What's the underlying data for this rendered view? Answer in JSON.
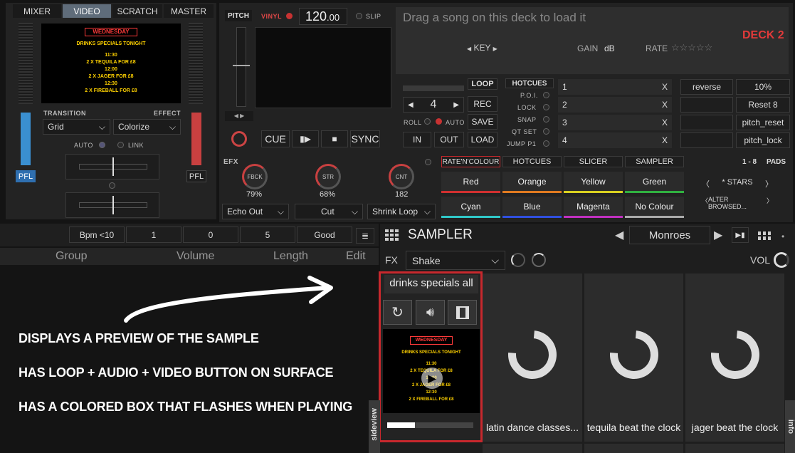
{
  "mixer": {
    "tabs": [
      "MIXER",
      "VIDEO",
      "SCRATCH",
      "MASTER"
    ],
    "active_tab": "VIDEO",
    "transition_label": "TRANSITION",
    "effect_label": "EFFECT",
    "transition_value": "Grid",
    "effect_value": "Colorize",
    "auto_label": "AUTO",
    "link_label": "LINK",
    "pfl_left": "PFL",
    "pfl_right": "PFL"
  },
  "preview_text": {
    "logo": "WEDNESDAY",
    "l1": "DRINKS SPECIALS TONIGHT",
    "l2": "11:30",
    "l3": "2 X TEQUILA FOR £8",
    "l4": "12:00",
    "l5": "2 X JAGER FOR £8",
    "l6": "12:30",
    "l7": "2 X FIREBALL FOR £8"
  },
  "deck": {
    "pitch_label": "PITCH",
    "vinyl_label": "VINYL",
    "bpm": "120",
    "bpm_dec": ".00",
    "slip_label": "SLIP",
    "drop_text": "Drag a song on this deck to load it",
    "deck_name": "DECK 2",
    "key_label": "KEY",
    "gain_label": "GAIN",
    "gain_unit": "dB",
    "rate_label": "RATE",
    "stars": "☆☆☆☆☆",
    "cue": "CUE",
    "play": "▮▶",
    "stop": "■",
    "sync": "SYNC"
  },
  "loop": {
    "label": "LOOP",
    "value": "4",
    "rec": "REC",
    "save": "SAVE",
    "load": "LOAD",
    "roll": "ROLL",
    "auto": "AUTO",
    "in": "IN",
    "out": "OUT"
  },
  "hotcues": {
    "label": "HOTCUES",
    "poi": "P.O.I.",
    "lock": "LOCK",
    "snap": "SNAP",
    "qtset": "QT SET",
    "jump": "JUMP P1",
    "slots": [
      {
        "n": "1",
        "x": "X"
      },
      {
        "n": "2",
        "x": "X"
      },
      {
        "n": "3",
        "x": "X"
      },
      {
        "n": "4",
        "x": "X"
      }
    ]
  },
  "actions": {
    "reverse": "reverse",
    "pct": "10%",
    "reset": "Reset 8",
    "pitch_reset": "pitch_reset",
    "pitch_lock": "pitch_lock"
  },
  "efx": {
    "label": "EFX",
    "k1": "FBCK",
    "v1": "79%",
    "k2": "STR",
    "v2": "68%",
    "k3": "CNT",
    "v3": "182",
    "d1": "Echo Out",
    "d2": "Cut",
    "d3": "Shrink Loop"
  },
  "pads": {
    "tabs": [
      "RATE'N'COLOUR",
      "HOTCUES",
      "SLICER",
      "SAMPLER"
    ],
    "range": "1 - 8",
    "pads_label": "PADS",
    "cells": [
      "Red",
      "Orange",
      "Yellow",
      "Green",
      "Cyan",
      "Blue",
      "Magenta",
      "No Colour"
    ],
    "colors": [
      "#d03030",
      "#e07a20",
      "#d8d020",
      "#30b040",
      "#30c8c8",
      "#3050e0",
      "#c030c0",
      "#aaaaaa"
    ],
    "stars_label": "* STARS",
    "alter_label": "ALTER BROWSED..."
  },
  "browser": {
    "filters": [
      "Bpm <10",
      "1",
      "0",
      "5",
      "Good"
    ],
    "columns": [
      "Group",
      "Volume",
      "Length",
      "Edit"
    ]
  },
  "sampler": {
    "title": "SAMPLER",
    "preset": "Monroes",
    "fx_label": "FX",
    "fx_value": "Shake",
    "vol_label": "VOL",
    "first_tile": "drinks specials all",
    "tiles": [
      "latin dance classes...",
      "tequila beat the clock",
      "jager beat the clock"
    ],
    "highlight_color": "#c8282d"
  },
  "side": {
    "left": "sideview",
    "right": "info"
  },
  "notes": [
    "DISPLAYS A PREVIEW OF THE SAMPLE",
    "HAS LOOP + AUDIO + VIDEO BUTTON ON SURFACE",
    "HAS A COLORED BOX THAT FLASHES WHEN PLAYING"
  ]
}
